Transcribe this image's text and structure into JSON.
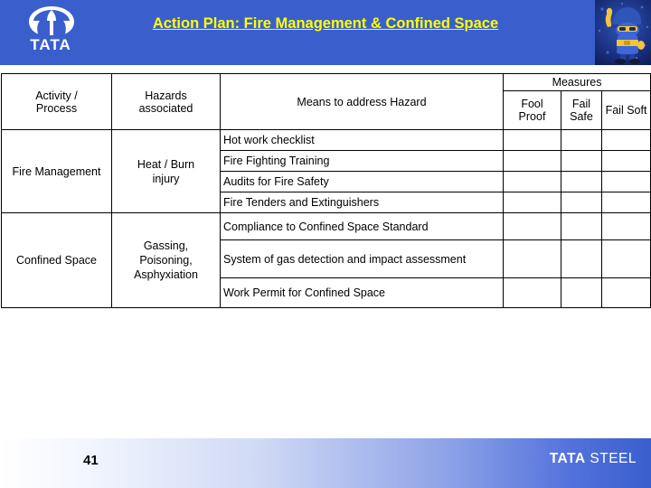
{
  "header": {
    "title": "Action Plan: Fire Management & Confined Space",
    "brand_wordmark": "TATA",
    "logo_icon": "tata-t-emblem-icon",
    "mascot_icon": "safety-mascot-icon",
    "band_color": "#3a5fcd",
    "title_color": "#ffff00"
  },
  "table": {
    "columns": {
      "activity": "Activity / Process",
      "activity_line1": "Activity /",
      "activity_line2": "Process",
      "hazards": "Hazards associated",
      "hazards_line1": "Hazards",
      "hazards_line2": "associated",
      "means": "Means to address Hazard",
      "measures_group": "Measures",
      "measure_cols": [
        "Fool Proof",
        "Fail Safe",
        "Fail Soft"
      ]
    },
    "marker_color": "#00B050",
    "groups": [
      {
        "activity": "Fire Management",
        "hazard": "Heat / Burn injury",
        "hazard_line1": "Heat / Burn",
        "hazard_line2": "injury",
        "rows": [
          {
            "means": "Hot work checklist",
            "fool_proof": false,
            "fail_safe": false,
            "fail_soft": true
          },
          {
            "means": "Fire Fighting Training",
            "fool_proof": false,
            "fail_safe": false,
            "fail_soft": true
          },
          {
            "means": "Audits for Fire Safety",
            "fool_proof": false,
            "fail_safe": false,
            "fail_soft": true
          },
          {
            "means": "Fire Tenders and Extinguishers",
            "fool_proof": false,
            "fail_safe": false,
            "fail_soft": true
          }
        ]
      },
      {
        "activity": "Confined Space",
        "hazard": "Gassing, Poisoning, Asphyxiation",
        "hazard_line1": "Gassing,",
        "hazard_line2": "Poisoning,",
        "hazard_line3": "Asphyxiation",
        "rows": [
          {
            "means": "Compliance to Confined Space Standard",
            "fool_proof": false,
            "fail_safe": false,
            "fail_soft": true
          },
          {
            "means": "System of gas detection and impact assessment",
            "fool_proof": false,
            "fail_safe": true,
            "fail_soft": false
          },
          {
            "means": "Work Permit for Confined Space",
            "fool_proof": true,
            "fail_safe": false,
            "fail_soft": false
          }
        ]
      }
    ]
  },
  "footer": {
    "page_number": "41",
    "logo_bold": "TATA",
    "logo_thin": "STEEL"
  }
}
